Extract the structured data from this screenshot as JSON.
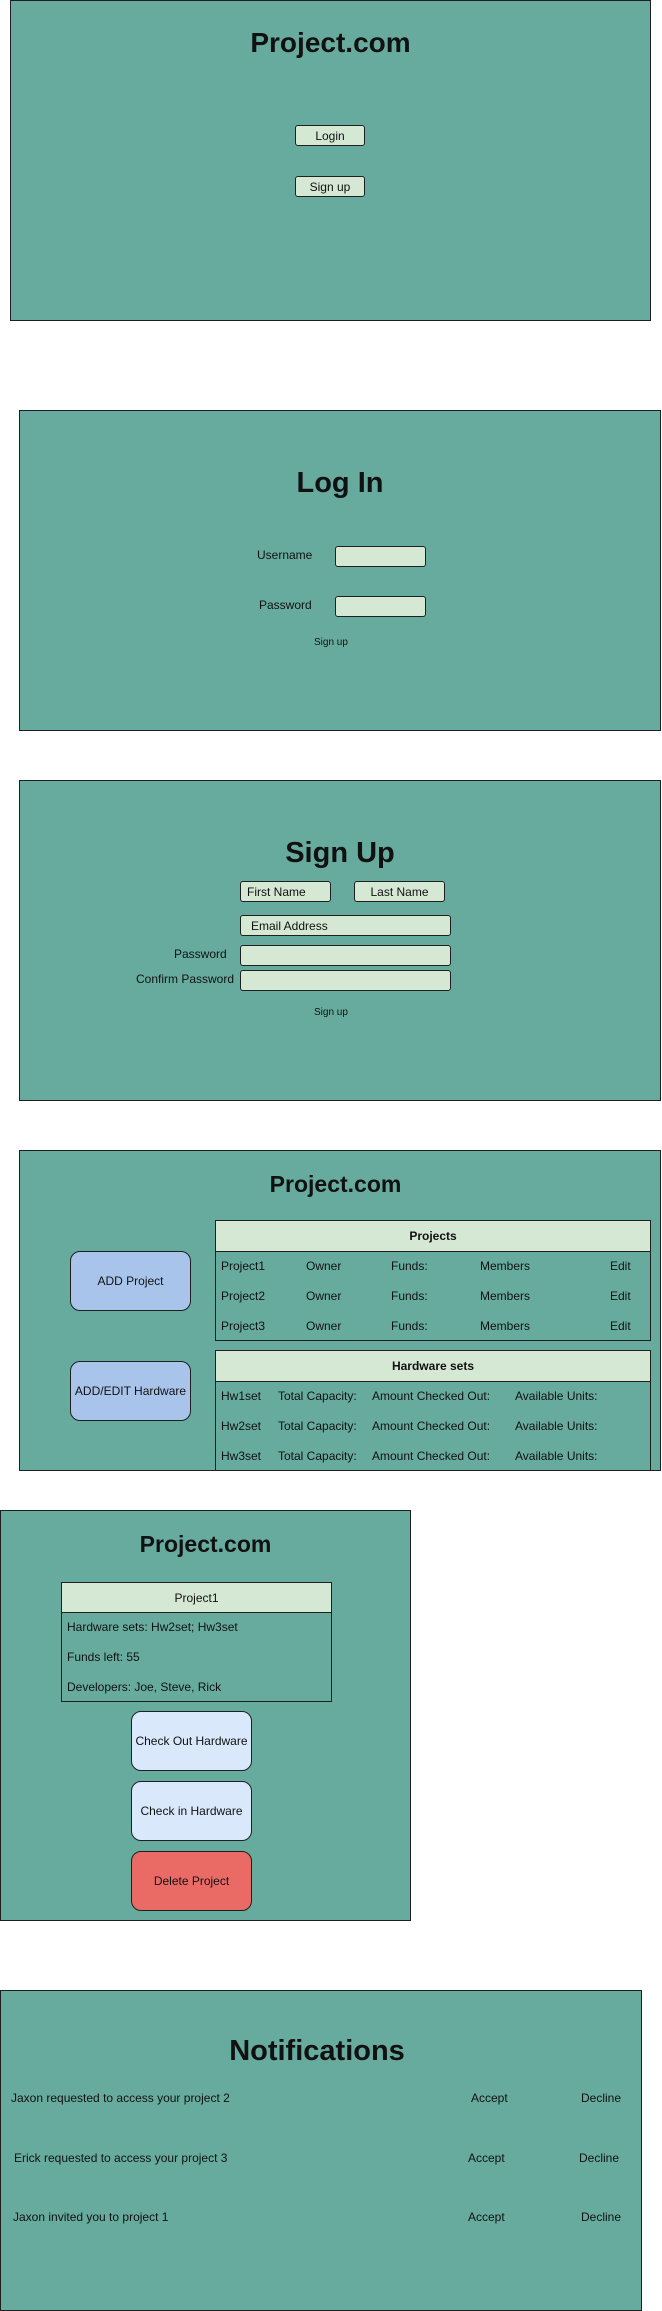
{
  "landing": {
    "title": "Project.com",
    "login_label": "Login",
    "signup_label": "Sign up"
  },
  "login": {
    "title": "Log In",
    "username_label": "Username",
    "password_label": "Password",
    "signup_link": "Sign up"
  },
  "signup": {
    "title": "Sign Up",
    "first_name": "First Name",
    "last_name": "Last Name",
    "email": "Email Address",
    "password_label": "Password",
    "confirm_label": "Confirm Password",
    "signup_link": "Sign up"
  },
  "dashboard": {
    "title": "Project.com",
    "add_project": "ADD Project",
    "add_edit_hardware": "ADD/EDIT Hardware",
    "projects_header": "Projects",
    "projects": [
      {
        "name": "Project1",
        "owner": "Owner",
        "funds": "Funds:",
        "members": "Members",
        "edit": "Edit"
      },
      {
        "name": "Project2",
        "owner": "Owner",
        "funds": "Funds:",
        "members": "Members",
        "edit": "Edit"
      },
      {
        "name": "Project3",
        "owner": "Owner",
        "funds": "Funds:",
        "members": "Members",
        "edit": "Edit"
      }
    ],
    "hardware_header": "Hardware sets",
    "hardware": [
      {
        "name": "Hw1set",
        "capacity": "Total Capacity:",
        "checked": "Amount Checked Out:",
        "available": "Available Units:"
      },
      {
        "name": "Hw2set",
        "capacity": "Total Capacity:",
        "checked": "Amount Checked Out:",
        "available": "Available Units:"
      },
      {
        "name": "Hw3set",
        "capacity": "Total Capacity:",
        "checked": "Amount Checked Out:",
        "available": "Available Units:"
      }
    ]
  },
  "project_detail": {
    "title": "Project.com",
    "card_header": "Project1",
    "lines": [
      "Hardware sets: Hw2set; Hw3set",
      "Funds left: 55",
      "Developers: Joe, Steve, Rick"
    ],
    "checkout": "Check Out Hardware",
    "checkin": "Check in Hardware",
    "delete": "Delete Project"
  },
  "notifications": {
    "title": "Notifications",
    "items": [
      {
        "text": "Jaxon requested to access your project 2",
        "accept": "Accept",
        "decline": "Decline"
      },
      {
        "text": "Erick requested to access your project 3",
        "accept": "Accept",
        "decline": "Decline"
      },
      {
        "text": "Jaxon invited you to  project 1",
        "accept": "Accept",
        "decline": "Decline"
      }
    ]
  },
  "colors": {
    "panel": "#67ab9f",
    "field": "#d5e8d4",
    "button_blue": "#a9c4eb",
    "button_lightblue": "#dae8fc",
    "button_red": "#ea6b66"
  }
}
